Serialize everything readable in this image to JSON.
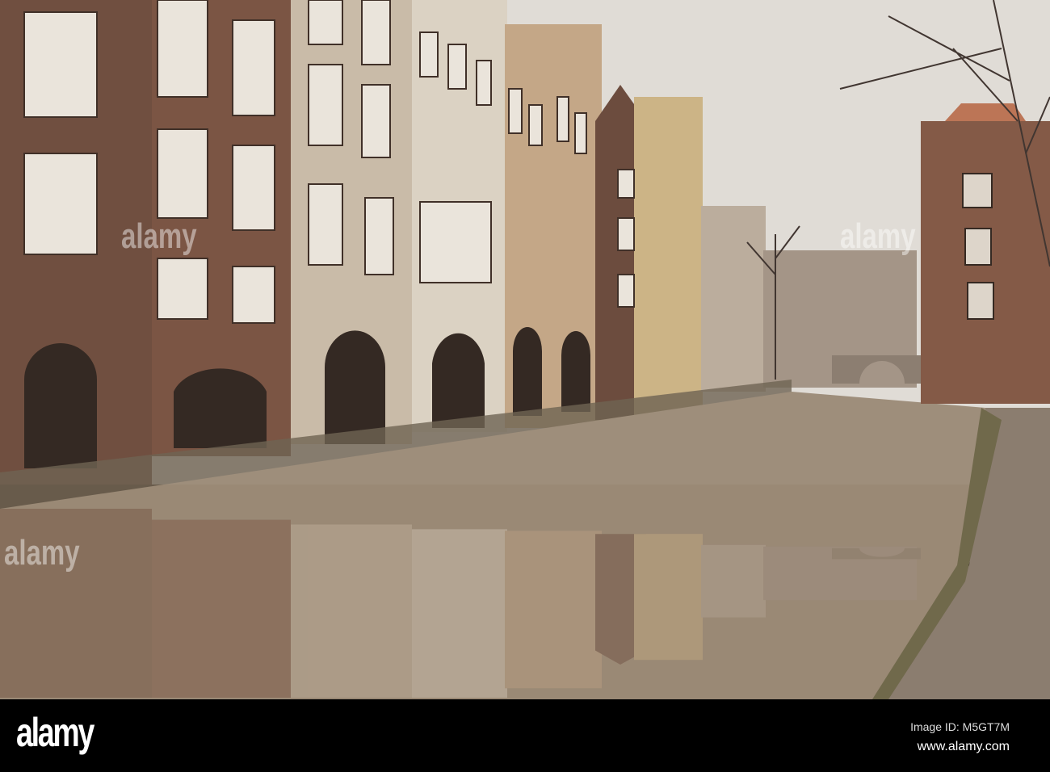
{
  "photo": {
    "subject": "Canal with reflected historic houses",
    "colors": {
      "sky": "#e6e4e1",
      "water": "#9e9080",
      "brick": "#6b4a3c",
      "beige": "#cfc2ae",
      "white": "#e3ddd2",
      "tan": "#c9ad8c"
    }
  },
  "watermark": {
    "logo": "alamy",
    "image_id": "Image ID: M5GT7M",
    "site": "www.alamy.com"
  }
}
